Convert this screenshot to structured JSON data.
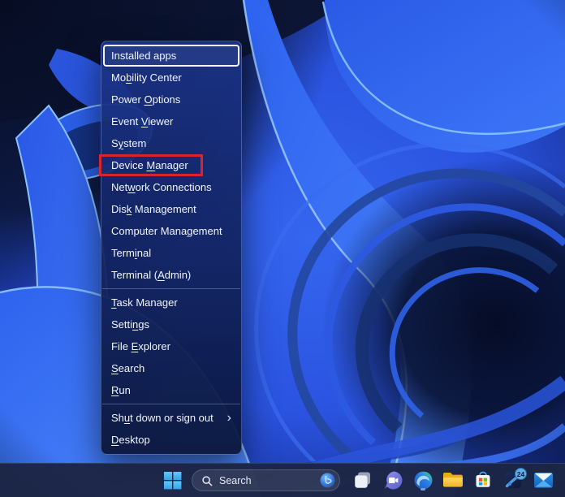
{
  "menu": {
    "items": [
      {
        "label": "Installed apps",
        "focused": true
      },
      {
        "label": "Mobility Center",
        "underline": "b"
      },
      {
        "label": "Power Options",
        "underline": "O"
      },
      {
        "label": "Event Viewer",
        "underline": "V"
      },
      {
        "label": "System",
        "underline": "y"
      },
      {
        "label": "Device Manager",
        "underline": "M",
        "annotated": true
      },
      {
        "label": "Network Connections",
        "underline": "w"
      },
      {
        "label": "Disk Management",
        "underline": "k"
      },
      {
        "label": "Computer Management",
        "underline": "g"
      },
      {
        "label": "Terminal",
        "underline": "i"
      },
      {
        "label": "Terminal (Admin)",
        "underline": "A"
      },
      {
        "type": "separator"
      },
      {
        "label": "Task Manager",
        "underline": "T"
      },
      {
        "label": "Settings",
        "underline": "n"
      },
      {
        "label": "File Explorer",
        "underline": "E"
      },
      {
        "label": "Search",
        "underline": "S"
      },
      {
        "label": "Run",
        "underline": "R"
      },
      {
        "type": "separator"
      },
      {
        "label": "Shut down or sign out",
        "underline": "u",
        "has_submenu": true,
        "chevron": "›"
      },
      {
        "label": "Desktop",
        "underline": "D"
      }
    ]
  },
  "annotation": {
    "target": "Device Manager",
    "color": "#d9252a"
  },
  "taskbar": {
    "search": {
      "placeholder": "Search"
    },
    "badge_count": "24",
    "icons": [
      "start",
      "task-view",
      "chat",
      "edge",
      "file-explorer",
      "microsoft-store",
      "app-with-badge",
      "mail"
    ]
  },
  "colors": {
    "annotation_red": "#d9252a",
    "taskbar_bg": "#1c2544",
    "menu_text": "#f1f5ff",
    "wallpaper_blue": "#2e63f0"
  }
}
